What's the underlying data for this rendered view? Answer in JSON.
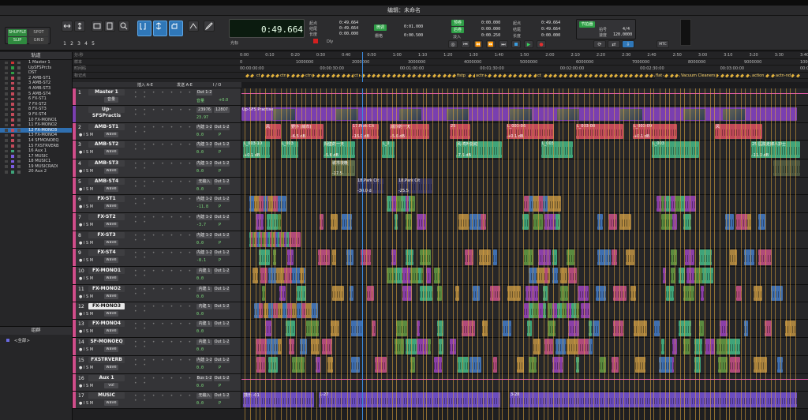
{
  "window": {
    "title": "编辑：未命名"
  },
  "toolbar": {
    "modes": [
      "SHUFFLE",
      "SPOT",
      "SLIP",
      "GRID"
    ],
    "zoom_presets": [
      "1",
      "2",
      "3",
      "4",
      "5"
    ],
    "main_counter": "0:49.664",
    "cursor_label": "光标",
    "counters": {
      "start_label": "起点",
      "end_label": "结尾",
      "length_label": "长度",
      "start": "0:49.664",
      "end": "0:49.664",
      "length": "0:00.000",
      "nudge_label": "微调",
      "nudge": "0:01.000",
      "grid_label": "栅格",
      "grid": "0:00.500",
      "dly_label": "Dly"
    },
    "transport": {
      "preroll_label": "预卷",
      "postroll_label": "后卷",
      "fade_label": "淡入",
      "preroll": "0:00.000",
      "postroll": "0:00.000",
      "fade": "0:00.250",
      "t_start_label": "起点",
      "t_end_label": "结尾",
      "t_length_label": "长度",
      "t_start": "0:49.664",
      "t_end": "0:49.664",
      "t_length": "0:00.000",
      "mtc_label": "MTC"
    },
    "tempo": {
      "label1": "节拍器",
      "label2": "拍号",
      "label3": "速度",
      "meter": "4/4",
      "tempo": "120.0000"
    }
  },
  "track_list": {
    "header": "轨道",
    "items": [
      "1 Master 1",
      "UpSFSPrcts",
      "DST",
      "2 AMB-ST1",
      "3 AMB-ST2",
      "4 AMB-ST3",
      "5 AMB-ST4",
      "6 FX-ST1",
      "7 FX-ST2",
      "8 FX-ST3",
      "9 FX-ST4",
      "10 FX-MONO1",
      "11 FX-MONO2",
      "12 FX-MONO3",
      "13 FX-MONO4",
      "14 SFMONOEQ",
      "15 FXSTRVERB",
      "16 Aux 1",
      "17 MUSIC",
      "18 MUSIC1",
      "19 MUSICRADI",
      "20 Aux 2"
    ],
    "selected_index": 13
  },
  "groups": {
    "header": "组群",
    "items": [
      "<全部>"
    ]
  },
  "rulers": {
    "labels": [
      "分:秒",
      "样本",
      "时间码",
      "标记点",
      "时间戳",
      "标记点"
    ],
    "minsec_ticks": [
      "0:00",
      "0:10",
      "0:20",
      "0:30",
      "0:40",
      "0:50",
      "1:00",
      "1:10",
      "1:20",
      "1:30",
      "1:40",
      "1:50",
      "2:00",
      "2:10",
      "2:20",
      "2:30",
      "2:40",
      "2:50",
      "3:00",
      "3:10",
      "3:20",
      "3:30",
      "3:40"
    ],
    "samples_ticks": [
      "0",
      "1000000",
      "2000000",
      "3000000",
      "4000000",
      "5000000",
      "6000000",
      "7000000",
      "8000000",
      "9000000",
      "10000000"
    ],
    "timecode_ticks": [
      "00:00:00:00",
      "00:00:30:00",
      "00:01:00:00",
      "00:01:30:00",
      "00:02:00:00",
      "00:02:30:00",
      "00:03:00:00",
      "00:03:30:00"
    ],
    "marker_labels": [
      "ct",
      "ctn",
      "ctn",
      "ct",
      "fistp",
      "actn",
      "ct",
      "flat",
      "Vacuum Cleaners",
      "action",
      "actn-nd"
    ]
  },
  "columns": {
    "insert": "插入 A-E",
    "send": "发送 A-E",
    "io": "I / O"
  },
  "tracks": [
    {
      "num": "1",
      "name": "Master 1",
      "color": "#d04d8a",
      "in": "Out 1-2",
      "out": "",
      "vol": "音量",
      "vol_val": "+0.0",
      "view": "音量",
      "height": 22
    },
    {
      "num": "",
      "name": "Up-SFSPractis",
      "color": "#7a3fb0",
      "in": "23976",
      "out": "12807",
      "vol": "23.97",
      "vol_val": "",
      "view": "",
      "height": 22,
      "video": true
    },
    {
      "num": "2",
      "name": "AMB-ST1",
      "color": "#d04d8a",
      "in": "内建 1-2",
      "out": "Out 1-2",
      "vol": "0.0",
      "vol_val": "P",
      "view": "wave",
      "height": 22
    },
    {
      "num": "3",
      "name": "AMB-ST2",
      "color": "#d04d8a",
      "in": "内建 1-2",
      "out": "Out 1-2",
      "vol": "0.0",
      "vol_val": "P",
      "view": "wave",
      "height": 24
    },
    {
      "num": "4",
      "name": "AMB-ST3",
      "color": "#d04d8a",
      "in": "内建 1-2",
      "out": "Out 1-2",
      "vol": "0.0",
      "vol_val": "P",
      "view": "wave",
      "height": 23
    },
    {
      "num": "5",
      "name": "AMB-ST4",
      "color": "#d04d8a",
      "in": "无输入",
      "out": "Out 1-2",
      "vol": "0.0",
      "vol_val": "P",
      "view": "wave",
      "height": 22
    },
    {
      "num": "6",
      "name": "FX-ST1",
      "color": "#d04d8a",
      "in": "内建 1-2",
      "out": "Out 1-2",
      "vol": "-11.8",
      "vol_val": "P",
      "view": "wave",
      "height": 23
    },
    {
      "num": "7",
      "name": "FX-ST2",
      "color": "#d04d8a",
      "in": "内建 1-2",
      "out": "Out 1-2",
      "vol": "-3.7",
      "vol_val": "P",
      "view": "wave",
      "height": 23
    },
    {
      "num": "8",
      "name": "FX-ST3",
      "color": "#d04d8a",
      "in": "内建 1-2",
      "out": "Out 1-2",
      "vol": "0.0",
      "vol_val": "P",
      "view": "wave",
      "height": 22
    },
    {
      "num": "9",
      "name": "FX-ST4",
      "color": "#d04d8a",
      "in": "内建 1-2",
      "out": "Out 1-2",
      "vol": "-8.1",
      "vol_val": "P",
      "view": "wave",
      "height": 23
    },
    {
      "num": "10",
      "name": "FX-MONO1",
      "color": "#d04d8a",
      "in": "内建 1",
      "out": "Out 1-2",
      "vol": "0.0",
      "vol_val": "",
      "view": "wave",
      "height": 23
    },
    {
      "num": "11",
      "name": "FX-MONO2",
      "color": "#d04d8a",
      "in": "内建 1",
      "out": "Out 1-2",
      "vol": "0.0",
      "vol_val": "",
      "view": "wave",
      "height": 22
    },
    {
      "num": "12",
      "name": "FX-MONO3",
      "color": "#d04d8a",
      "in": "内建 1",
      "out": "Out 1-2",
      "vol": "0.0",
      "vol_val": "",
      "view": "wave",
      "height": 22,
      "selected": true
    },
    {
      "num": "13",
      "name": "FX-MONO4",
      "color": "#d04d8a",
      "in": "内建 1",
      "out": "Out 1-2",
      "vol": "0.0",
      "vol_val": "",
      "view": "wave",
      "height": 23
    },
    {
      "num": "14",
      "name": "SF-MONOEQ",
      "color": "#d04d8a",
      "in": "内建 1",
      "out": "Out 1-2",
      "vol": "0.0",
      "vol_val": "",
      "view": "wave",
      "height": 23
    },
    {
      "num": "15",
      "name": "FXSTRVERB",
      "color": "#d04d8a",
      "in": "内建 1-2",
      "out": "Out 1-2",
      "vol": "0.0",
      "vol_val": "P",
      "view": "wave",
      "height": 23
    },
    {
      "num": "16",
      "name": "Aux 1",
      "color": "#d04d8a",
      "in": "Bus 1-2",
      "out": "Out 1-2",
      "vol": "0.0",
      "vol_val": "P",
      "view": "vol",
      "height": 22
    },
    {
      "num": "17",
      "name": "MUSIC",
      "color": "#d04d8a",
      "in": "无输入",
      "out": "Out 1-2",
      "vol": "0.0",
      "vol_val": "P",
      "view": "wave",
      "height": 22
    }
  ],
  "clips": {
    "video": [
      {
        "name": "Up-SFS Practise"
      }
    ],
    "amb1": [
      "风",
      "野外 (城市)",
      "17.Park Cit",
      "潮汐的一天",
      "25",
      "L_003-06",
      "L_003-08",
      "L_003-09",
      "风",
      "-6.5 dB",
      "-16.0 dB",
      "-5.6 dB",
      "+0.1 dB",
      "+0.1 dB"
    ],
    "amb2": [
      "L_003-10",
      "L_003",
      "隔壁的一天",
      "L_0",
      "风-鸣叶摇动",
      "L_003",
      "L_003",
      "25 医院走廊人护士",
      "+0.1 dB",
      "-5.6 dB",
      "-7.5 dB",
      "-11.0 dB"
    ],
    "amb3": [
      "城市夜晚",
      "-17.5"
    ],
    "amb4": [
      "18.Park Cit",
      "18.Park Cit",
      "-30.0 d",
      "-25.5"
    ],
    "music": [
      "鼓乐 -01",
      "1-27",
      "3-28"
    ]
  },
  "colors": {
    "accent": "#2f77b8",
    "amb": "#c24a5a",
    "fx": "#3fa47a",
    "video": "#7a3fb0",
    "music": "#6a4cc0",
    "marker": "#e3b23c"
  }
}
